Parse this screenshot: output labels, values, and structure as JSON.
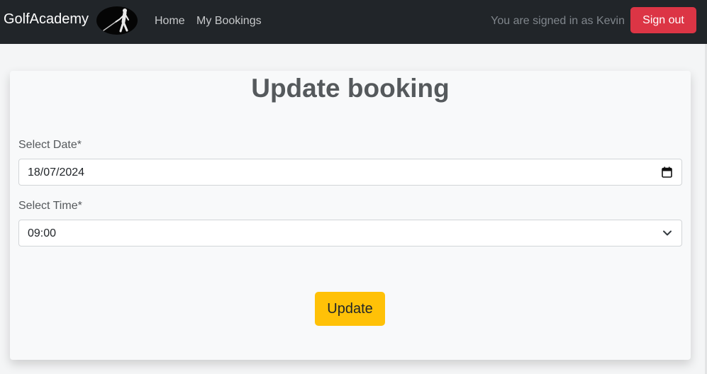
{
  "navbar": {
    "brand": "GolfAcademy",
    "links": [
      {
        "label": "Home"
      },
      {
        "label": "My Bookings"
      }
    ],
    "signed_in_text": "You are signed in as Kevin",
    "sign_out_label": "Sign out"
  },
  "form": {
    "title": "Update booking",
    "date_label": "Select Date*",
    "date_value": "18/07/2024",
    "time_label": "Select Time*",
    "time_value": "09:00",
    "submit_label": "Update"
  },
  "icons": {
    "logo": "golfer-logo-icon",
    "date": "calendar-icon",
    "time": "chevron-down-icon"
  },
  "colors": {
    "navbar_bg": "#212529",
    "sign_out_bg": "#dc3545",
    "update_bg": "#ffc107",
    "page_bg": "#f4f5f6",
    "card_bg": "#f8f9fa"
  }
}
